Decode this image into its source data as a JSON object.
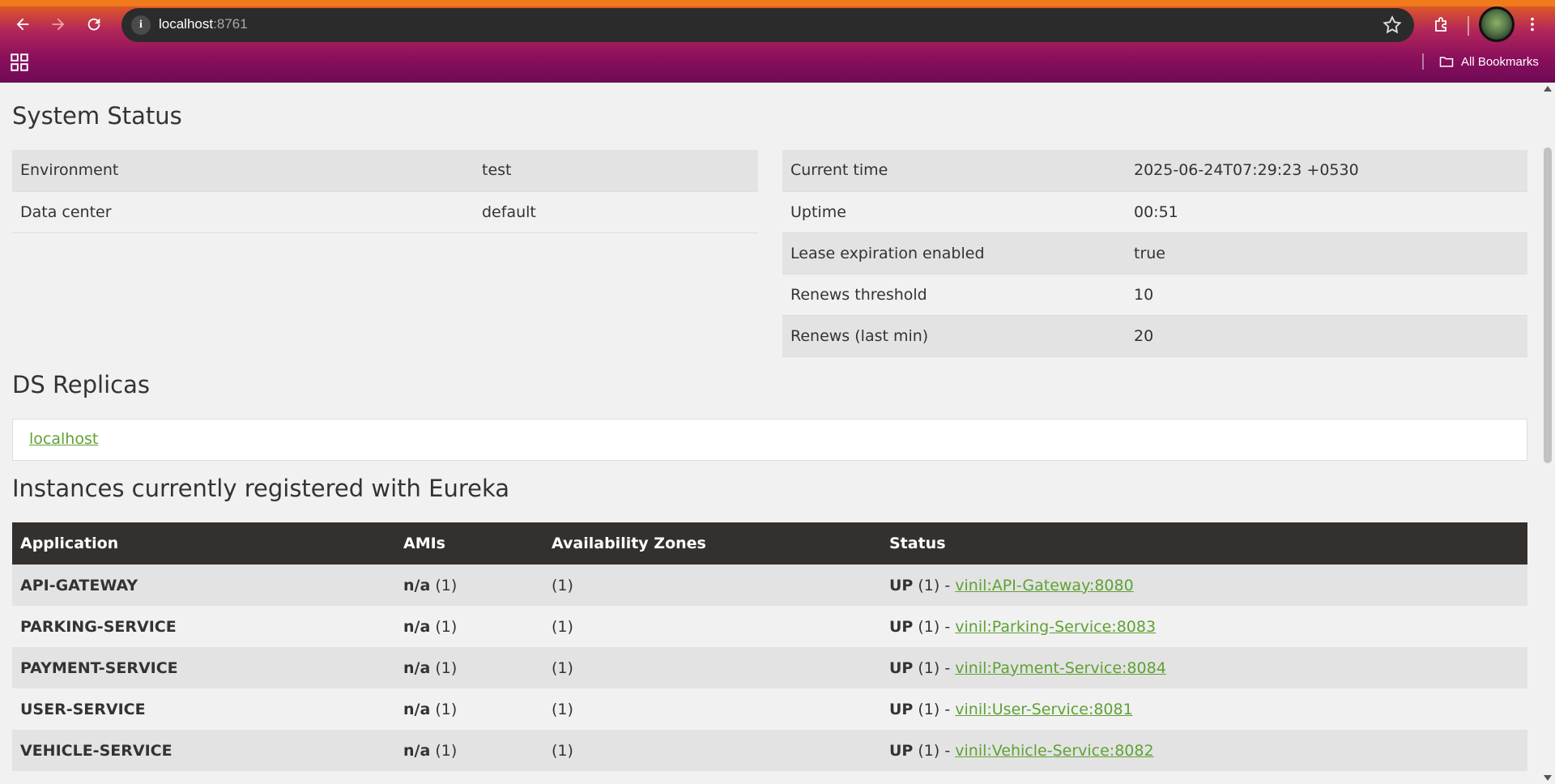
{
  "browser": {
    "url_host": "localhost",
    "url_port": ":8761",
    "bookmarks_label": "All Bookmarks"
  },
  "system_status": {
    "title": "System Status",
    "left": [
      {
        "key": "Environment",
        "value": "test"
      },
      {
        "key": "Data center",
        "value": "default"
      }
    ],
    "right": [
      {
        "key": "Current time",
        "value": "2025-06-24T07:29:23 +0530"
      },
      {
        "key": "Uptime",
        "value": "00:51"
      },
      {
        "key": "Lease expiration enabled",
        "value": "true"
      },
      {
        "key": "Renews threshold",
        "value": "10"
      },
      {
        "key": "Renews (last min)",
        "value": "20"
      }
    ]
  },
  "ds_replicas": {
    "title": "DS Replicas",
    "link": "localhost"
  },
  "instances": {
    "title": "Instances currently registered with Eureka",
    "headers": [
      "Application",
      "AMIs",
      "Availability Zones",
      "Status"
    ],
    "rows": [
      {
        "app": "API-GATEWAY",
        "ami_bold": "n/a",
        "ami_count": " (1)",
        "zones": "(1)",
        "status_bold": "UP",
        "status_count": " (1) - ",
        "instance": "vinil:API-Gateway:8080"
      },
      {
        "app": "PARKING-SERVICE",
        "ami_bold": "n/a",
        "ami_count": " (1)",
        "zones": "(1)",
        "status_bold": "UP",
        "status_count": " (1) - ",
        "instance": "vinil:Parking-Service:8083"
      },
      {
        "app": "PAYMENT-SERVICE",
        "ami_bold": "n/a",
        "ami_count": " (1)",
        "zones": "(1)",
        "status_bold": "UP",
        "status_count": " (1) - ",
        "instance": "vinil:Payment-Service:8084"
      },
      {
        "app": "USER-SERVICE",
        "ami_bold": "n/a",
        "ami_count": " (1)",
        "zones": "(1)",
        "status_bold": "UP",
        "status_count": " (1) - ",
        "instance": "vinil:User-Service:8081"
      },
      {
        "app": "VEHICLE-SERVICE",
        "ami_bold": "n/a",
        "ami_count": " (1)",
        "zones": "(1)",
        "status_bold": "UP",
        "status_count": " (1) - ",
        "instance": "vinil:Vehicle-Service:8082"
      }
    ]
  },
  "colors": {
    "link": "#5fa134",
    "table_header_bg": "#34302d",
    "row_alt_bg": "#e3e3e3",
    "page_bg": "#f1f1f1"
  }
}
